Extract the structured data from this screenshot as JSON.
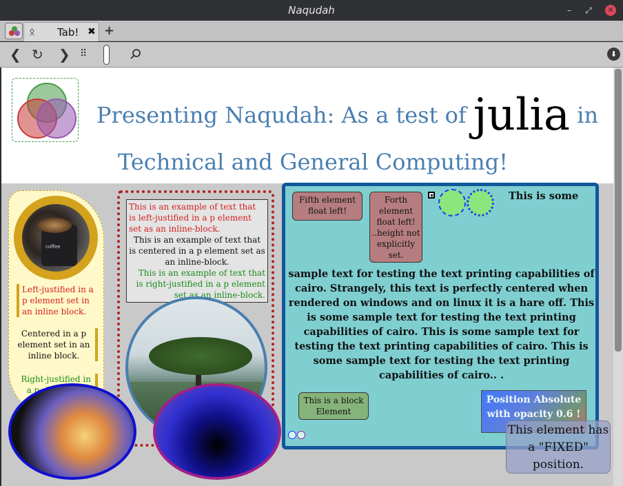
{
  "window": {
    "title": "Naqudah",
    "minimize_icon": "minimize-icon",
    "maximize_icon": "maximize-icon",
    "close_icon": "close-icon"
  },
  "tabs": {
    "items": [
      {
        "label": "Tab!",
        "icon": "julia-stickman-icon",
        "close_glyph": "✖"
      }
    ],
    "add_glyph": "+"
  },
  "nav": {
    "back_glyph": "❮",
    "reload_glyph": "↻",
    "forward_glyph": "❯",
    "apps_glyph": "⠿",
    "url_value": "",
    "search_glyph": "⚲",
    "download_glyph": "⬇"
  },
  "page": {
    "heading_prefix": "Presenting Naqudah: As a test of ",
    "heading_julia": "julia",
    "heading_suffix": " in",
    "heading_line2": "Technical and General Computing!",
    "left": {
      "photo_label": "coffee mug photo",
      "mug_text": "coffee",
      "p_left": "Left-justified in a p element set in an inline block.",
      "p_center": "Centered in a p element set in an inline block.",
      "p_right": "Right-justified in a p element set in an inline block."
    },
    "middle": {
      "red_text": "This is an example of text that is left-justified in a p element set as an inline-block.",
      "black_text": " This is an example of text that is centered in a p element set as an inline-block.",
      "green_text": " This is an example of text that is right-justified in a p element set as an inline-block."
    },
    "right": {
      "fifth_element": "Fifth element float left!",
      "forth_element": "Forth element float left! ..height not explicitly set.",
      "bold_top": "This is some",
      "bold_main": "sample text for testing the text printing capabilities of cairo. Strangely, this text is perfectly centered when rendered on windows and on linux it is a hare off. This is some sample text for testing the text printing capabilities of cairo. This is some sample text for testing the text printing capabilities of cairo. This is some sample text for testing the text printing capabilities of cairo.. .",
      "block_element": "This is a block Element",
      "absolute_element": "Position Absolute with opacity 0.6 !"
    },
    "fixed_element": "This element has a \"FIXED\" position."
  },
  "colors": {
    "heading": "#4a7fb0",
    "panel_bg": "#7fcfd1",
    "panel_border": "#10579b",
    "red_text": "#d42020",
    "green_text": "#1a8c1a",
    "gold": "#d4a21d"
  }
}
